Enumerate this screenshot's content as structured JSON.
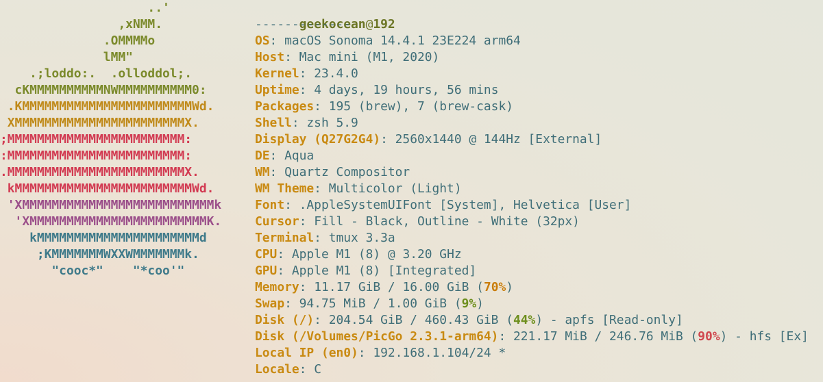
{
  "colors": {
    "key": "#c98a12",
    "value": "#3f6e78",
    "title": "#6b7524",
    "logo_green": "#7b8a2b",
    "logo_yellow": "#c08a1a",
    "logo_orange": "#cf6a2a",
    "logo_red": "#d23b52",
    "logo_purple": "#9b4f8a",
    "logo_blue": "#3f7a8a",
    "pct_warn": "#c97d0b",
    "pct_ok": "#6e8f1e",
    "pct_bad": "#d0474e"
  },
  "logo": [
    {
      "text": "                    ..'",
      "color": "#7b8a2b"
    },
    {
      "text": "                ,xNMM.",
      "color": "#7b8a2b"
    },
    {
      "text": "              .OMMMMo",
      "color": "#7b8a2b"
    },
    {
      "text": "              lMM\"",
      "color": "#7b8a2b"
    },
    {
      "text": "    .;loddo:.  .olloddol;.",
      "color": "#7b8a2b"
    },
    {
      "text": "  cKMMMMMMMMMMNWMMMMMMMMMM0:",
      "color": "#7b8a2b"
    },
    {
      "text": " .KMMMMMMMMMMMMMMMMMMMMMMMWd.",
      "color": "#c08a1a"
    },
    {
      "text": " XMMMMMMMMMMMMMMMMMMMMMMMX.",
      "color": "#c08a1a"
    },
    {
      "text": ";MMMMMMMMMMMMMMMMMMMMMMMM:",
      "color": "#d23b52"
    },
    {
      "text": ":MMMMMMMMMMMMMMMMMMMMMMMM:",
      "color": "#d23b52"
    },
    {
      "text": ".MMMMMMMMMMMMMMMMMMMMMMMMX.",
      "color": "#d23b52"
    },
    {
      "text": " kMMMMMMMMMMMMMMMMMMMMMMMMWd.",
      "color": "#d23b52"
    },
    {
      "text": " 'XMMMMMMMMMMMMMMMMMMMMMMMMMMk",
      "color": "#9b4f8a"
    },
    {
      "text": "  'XMMMMMMMMMMMMMMMMMMMMMMMMK.",
      "color": "#9b4f8a"
    },
    {
      "text": "    kMMMMMMMMMMMMMMMMMMMMMMd",
      "color": "#3f7a8a"
    },
    {
      "text": "     ;KMMMMMMMWXXWMMMMMMMk.",
      "color": "#3f7a8a"
    },
    {
      "text": "       \"cooc*\"    \"*coo'\"",
      "color": "#3f7a8a"
    }
  ],
  "title": {
    "user": "geekocean",
    "at": "@",
    "host": "192",
    "separator": "-------------"
  },
  "info": [
    {
      "key": "OS",
      "parts": [
        {
          "t": "macOS Sonoma 14.4.1 23E224 arm64"
        }
      ]
    },
    {
      "key": "Host",
      "parts": [
        {
          "t": "Mac mini (M1, 2020)"
        }
      ]
    },
    {
      "key": "Kernel",
      "parts": [
        {
          "t": "23.4.0"
        }
      ]
    },
    {
      "key": "Uptime",
      "parts": [
        {
          "t": "4 days, 19 hours, 56 mins"
        }
      ]
    },
    {
      "key": "Packages",
      "parts": [
        {
          "t": "195 (brew), 7 (brew-cask)"
        }
      ]
    },
    {
      "key": "Shell",
      "parts": [
        {
          "t": "zsh 5.9"
        }
      ]
    },
    {
      "key": "Display (Q27G2G4)",
      "parts": [
        {
          "t": "2560x1440 @ 144Hz [External]"
        }
      ]
    },
    {
      "key": "DE",
      "parts": [
        {
          "t": "Aqua"
        }
      ]
    },
    {
      "key": "WM",
      "parts": [
        {
          "t": "Quartz Compositor"
        }
      ]
    },
    {
      "key": "WM Theme",
      "parts": [
        {
          "t": "Multicolor (Light)"
        }
      ]
    },
    {
      "key": "Font",
      "parts": [
        {
          "t": ".AppleSystemUIFont [System], Helvetica [User]"
        }
      ]
    },
    {
      "key": "Cursor",
      "parts": [
        {
          "t": "Fill - Black, Outline - White (32px)"
        }
      ]
    },
    {
      "key": "Terminal",
      "parts": [
        {
          "t": "tmux 3.3a"
        }
      ]
    },
    {
      "key": "CPU",
      "parts": [
        {
          "t": "Apple M1 (8) @ 3.20 GHz"
        }
      ]
    },
    {
      "key": "GPU",
      "parts": [
        {
          "t": "Apple M1 (8) [Integrated]"
        }
      ]
    },
    {
      "key": "Memory",
      "parts": [
        {
          "t": "11.17 GiB / 16.00 GiB ("
        },
        {
          "t": "70%",
          "c": "hi-warn"
        },
        {
          "t": ")"
        }
      ]
    },
    {
      "key": "Swap",
      "parts": [
        {
          "t": "94.75 MiB / 1.00 GiB ("
        },
        {
          "t": "9%",
          "c": "hi-ok"
        },
        {
          "t": ")"
        }
      ]
    },
    {
      "key": "Disk (/)",
      "parts": [
        {
          "t": "204.54 GiB / 460.43 GiB ("
        },
        {
          "t": "44%",
          "c": "hi-ok"
        },
        {
          "t": ") - apfs [Read-only]"
        }
      ]
    },
    {
      "key": "Disk (/Volumes/PicGo 2.3.1-arm64)",
      "parts": [
        {
          "t": "221.17 MiB / 246.76 MiB ("
        },
        {
          "t": "90%",
          "c": "hi-bad"
        },
        {
          "t": ") - hfs [Ex]"
        }
      ]
    },
    {
      "key": "Local IP (en0)",
      "parts": [
        {
          "t": "192.168.1.104/24 *"
        }
      ]
    },
    {
      "key": "Locale",
      "parts": [
        {
          "t": "C"
        }
      ]
    }
  ]
}
